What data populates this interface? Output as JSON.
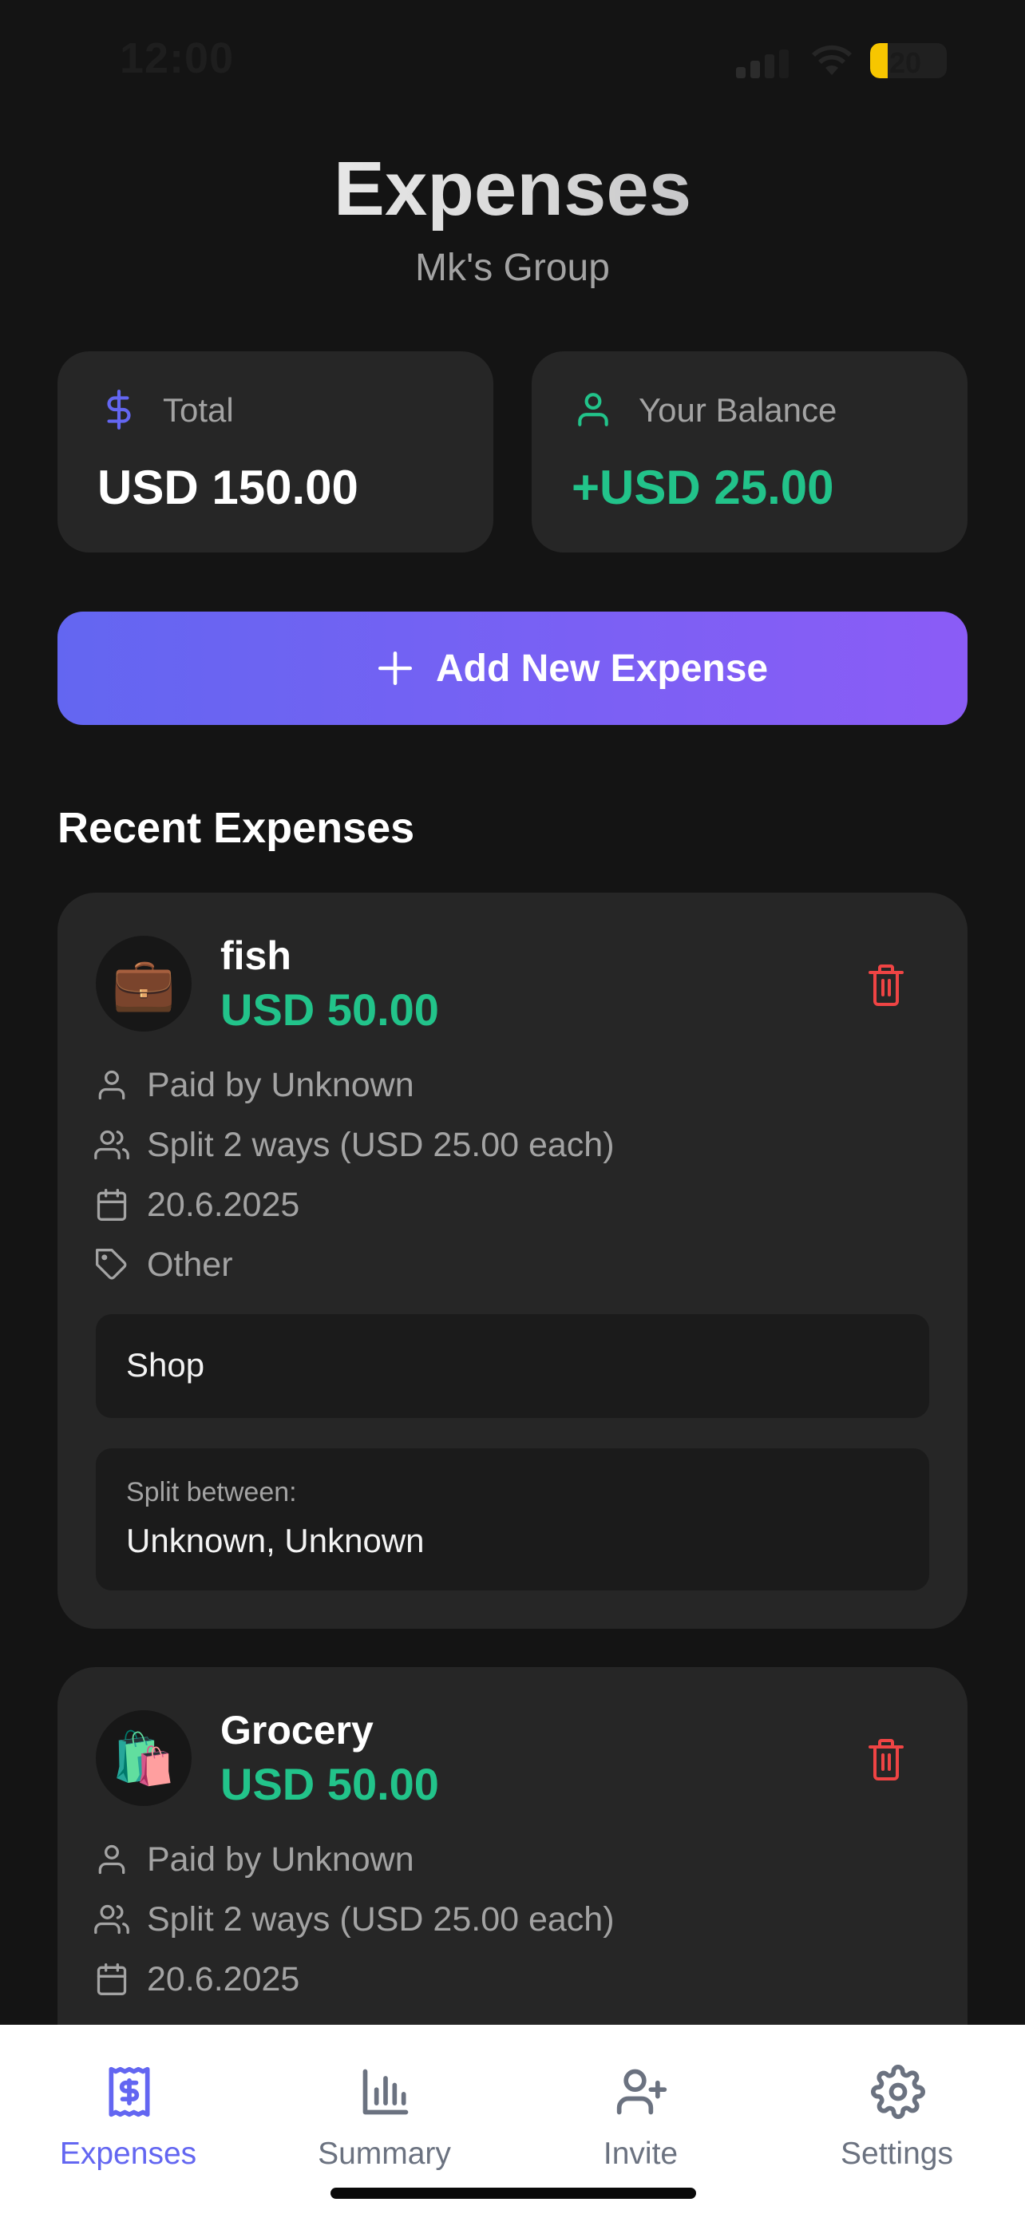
{
  "status_bar": {
    "time": "12:00",
    "battery": "20"
  },
  "header": {
    "title": "Expenses",
    "subtitle": "Mk's Group"
  },
  "stats": {
    "total": {
      "label": "Total",
      "value": "USD 150.00",
      "icon": "dollar-icon"
    },
    "balance": {
      "label": "Your Balance",
      "value": "+USD 25.00",
      "icon": "user-icon"
    }
  },
  "add_button": {
    "label": "Add New Expense"
  },
  "recent": {
    "title": "Recent Expenses"
  },
  "expenses": [
    {
      "emoji": "💼",
      "name": "fish",
      "amount": "USD 50.00",
      "paid_by": "Paid by Unknown",
      "split": "Split 2 ways (USD 25.00 each)",
      "date": "20.6.2025",
      "category": "Other",
      "note": "Shop",
      "split_label": "Split between:",
      "split_names": "Unknown, Unknown"
    },
    {
      "emoji": "🛍️",
      "name": "Grocery",
      "amount": "USD 50.00",
      "paid_by": "Paid by Unknown",
      "split": "Split 2 ways (USD 25.00 each)",
      "date": "20.6.2025"
    }
  ],
  "tabs": [
    {
      "label": "Expenses",
      "icon": "receipt-icon",
      "active": true
    },
    {
      "label": "Summary",
      "icon": "bar-chart-icon",
      "active": false
    },
    {
      "label": "Invite",
      "icon": "user-plus-icon",
      "active": false
    },
    {
      "label": "Settings",
      "icon": "gear-icon",
      "active": false
    }
  ],
  "colors": {
    "accent": "#6366f1",
    "accent_end": "#8b5cf6",
    "positive": "#22c38a",
    "danger": "#ef4444",
    "card": "#262626",
    "background": "#141414"
  }
}
